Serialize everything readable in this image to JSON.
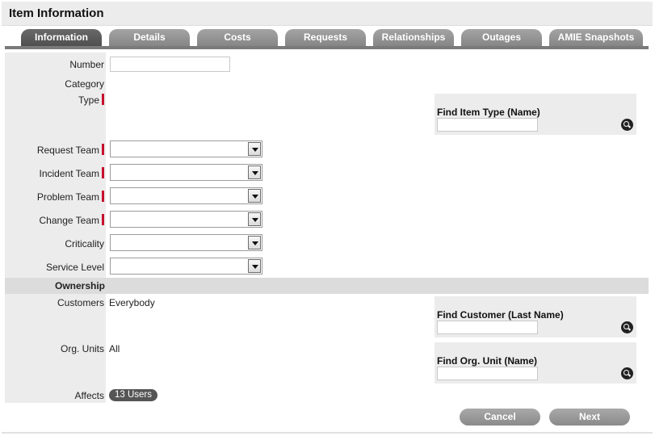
{
  "window": {
    "title": "Item Information"
  },
  "tabs": [
    {
      "label": "Information",
      "active": true
    },
    {
      "label": "Details"
    },
    {
      "label": "Costs"
    },
    {
      "label": "Requests"
    },
    {
      "label": "Relationships"
    },
    {
      "label": "Outages"
    },
    {
      "label": "AMIE Snapshots"
    }
  ],
  "form": {
    "number": {
      "label": "Number",
      "value": ""
    },
    "category": {
      "label": "Category",
      "value": ""
    },
    "type": {
      "label": "Type",
      "required": true
    },
    "request_team": {
      "label": "Request Team",
      "value": ""
    },
    "incident_team": {
      "label": "Incident Team",
      "value": ""
    },
    "problem_team": {
      "label": "Problem Team",
      "value": ""
    },
    "change_team": {
      "label": "Change Team",
      "value": ""
    },
    "criticality": {
      "label": "Criticality",
      "value": ""
    },
    "service_level": {
      "label": "Service Level",
      "value": ""
    }
  },
  "find_item_type": {
    "title": "Find Item Type (Name)",
    "value": ""
  },
  "ownership": {
    "header": "Ownership",
    "customers_label": "Customers",
    "customers_value": "Everybody",
    "org_units_label": "Org. Units",
    "org_units_value": "All",
    "affects_label": "Affects",
    "affects_value": "13 Users"
  },
  "find_customer": {
    "title": "Find Customer (Last Name)",
    "value": ""
  },
  "find_org_unit": {
    "title": "Find Org. Unit (Name)",
    "value": ""
  },
  "buttons": {
    "cancel": "Cancel",
    "next": "Next"
  },
  "colors": {
    "required_marker": "#c8102e",
    "tab_active": "#5a5a5a",
    "tab": "#969696"
  }
}
